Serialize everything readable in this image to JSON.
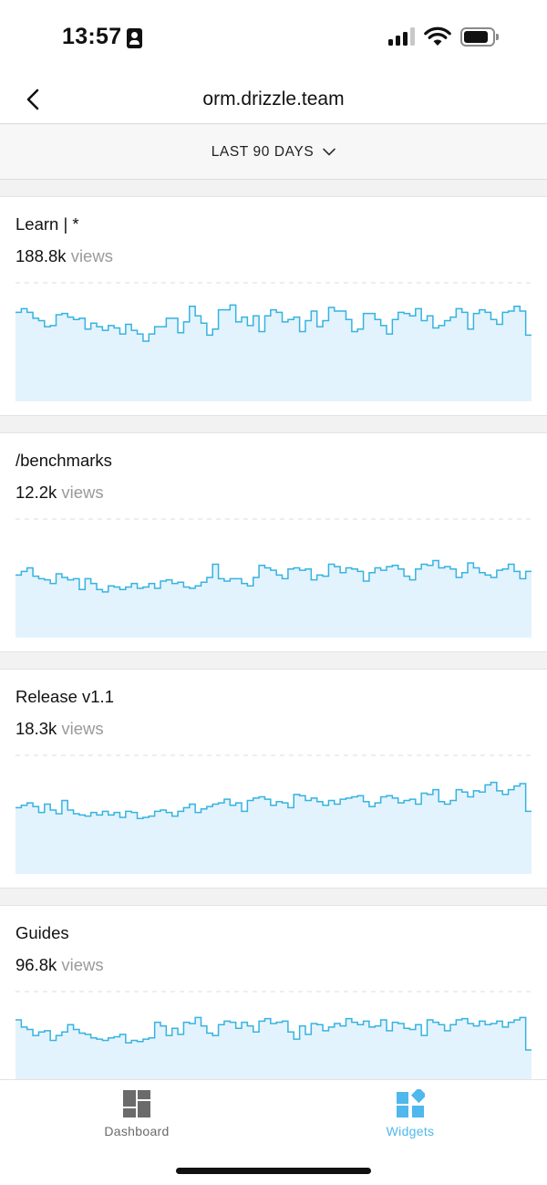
{
  "status_bar": {
    "time": "13:57"
  },
  "nav": {
    "title": "orm.drizzle.team"
  },
  "range": {
    "label": "LAST 90 DAYS"
  },
  "views_suffix": "views",
  "colors": {
    "line": "#36b3e0",
    "fill": "#e3f3fd",
    "grid": "#dcdcdc",
    "active_tab": "#4fb8ec",
    "inactive_tab": "#6b6b6b"
  },
  "cards": [
    {
      "title": "Learn | *",
      "views": "188.8k",
      "series": [
        74,
        77,
        74,
        69,
        67,
        62,
        63,
        72,
        73,
        70,
        68,
        69,
        60,
        65,
        62,
        59,
        63,
        61,
        56,
        64,
        59,
        56,
        50,
        56,
        62,
        62,
        69,
        69,
        57,
        66,
        79,
        71,
        65,
        55,
        60,
        76,
        76,
        80,
        66,
        70,
        63,
        71,
        58,
        71,
        76,
        74,
        66,
        68,
        70,
        58,
        67,
        75,
        62,
        67,
        78,
        75,
        75,
        68,
        58,
        60,
        73,
        73,
        68,
        63,
        56,
        68,
        74,
        73,
        71,
        77,
        67,
        71,
        61,
        63,
        67,
        70,
        77,
        74,
        60,
        73,
        76,
        74,
        68,
        64,
        74,
        75,
        79,
        75,
        55
      ]
    },
    {
      "title": "/benchmarks",
      "views": "12.2k",
      "series": [
        52,
        55,
        58,
        51,
        49,
        48,
        45,
        53,
        50,
        48,
        49,
        40,
        49,
        45,
        40,
        38,
        43,
        42,
        40,
        42,
        45,
        41,
        42,
        45,
        41,
        47,
        48,
        45,
        46,
        42,
        41,
        43,
        46,
        50,
        61,
        49,
        47,
        49,
        49,
        45,
        43,
        50,
        60,
        58,
        56,
        52,
        49,
        57,
        58,
        56,
        57,
        48,
        52,
        51,
        61,
        59,
        54,
        58,
        57,
        55,
        47,
        54,
        58,
        56,
        59,
        60,
        57,
        51,
        48,
        57,
        61,
        60,
        64,
        58,
        59,
        57,
        50,
        54,
        62,
        58,
        54,
        52,
        50,
        56,
        57,
        61,
        55,
        49,
        55
      ]
    },
    {
      "title": "Release v1.1",
      "views": "18.3k",
      "series": [
        55,
        57,
        59,
        56,
        51,
        58,
        53,
        50,
        61,
        53,
        50,
        49,
        48,
        51,
        49,
        52,
        49,
        51,
        47,
        52,
        51,
        46,
        47,
        48,
        52,
        53,
        51,
        48,
        52,
        55,
        58,
        51,
        54,
        56,
        58,
        59,
        62,
        57,
        59,
        52,
        61,
        63,
        64,
        62,
        57,
        60,
        59,
        55,
        66,
        65,
        61,
        63,
        60,
        57,
        61,
        58,
        62,
        63,
        64,
        65,
        60,
        56,
        59,
        64,
        65,
        63,
        59,
        61,
        62,
        58,
        67,
        66,
        70,
        60,
        58,
        61,
        70,
        68,
        64,
        69,
        68,
        74,
        76,
        69,
        66,
        70,
        73,
        75,
        52
      ]
    },
    {
      "title": "Guides",
      "views": "96.8k",
      "series": [
        75,
        69,
        67,
        62,
        65,
        66,
        58,
        62,
        65,
        71,
        67,
        64,
        63,
        60,
        59,
        58,
        60,
        61,
        63,
        56,
        58,
        57,
        59,
        60,
        73,
        70,
        62,
        68,
        63,
        73,
        72,
        77,
        70,
        64,
        62,
        71,
        74,
        73,
        68,
        73,
        70,
        65,
        74,
        76,
        72,
        73,
        74,
        65,
        59,
        70,
        63,
        72,
        71,
        66,
        69,
        72,
        70,
        76,
        73,
        71,
        74,
        69,
        70,
        75,
        66,
        73,
        72,
        68,
        67,
        71,
        62,
        75,
        73,
        71,
        66,
        71,
        75,
        76,
        72,
        70,
        74,
        71,
        72,
        74,
        69,
        73,
        75,
        77,
        50
      ]
    }
  ],
  "tabs": [
    {
      "label": "Dashboard",
      "icon": "dashboard-grid-icon",
      "active": false
    },
    {
      "label": "Widgets",
      "icon": "widgets-icon",
      "active": true
    }
  ]
}
